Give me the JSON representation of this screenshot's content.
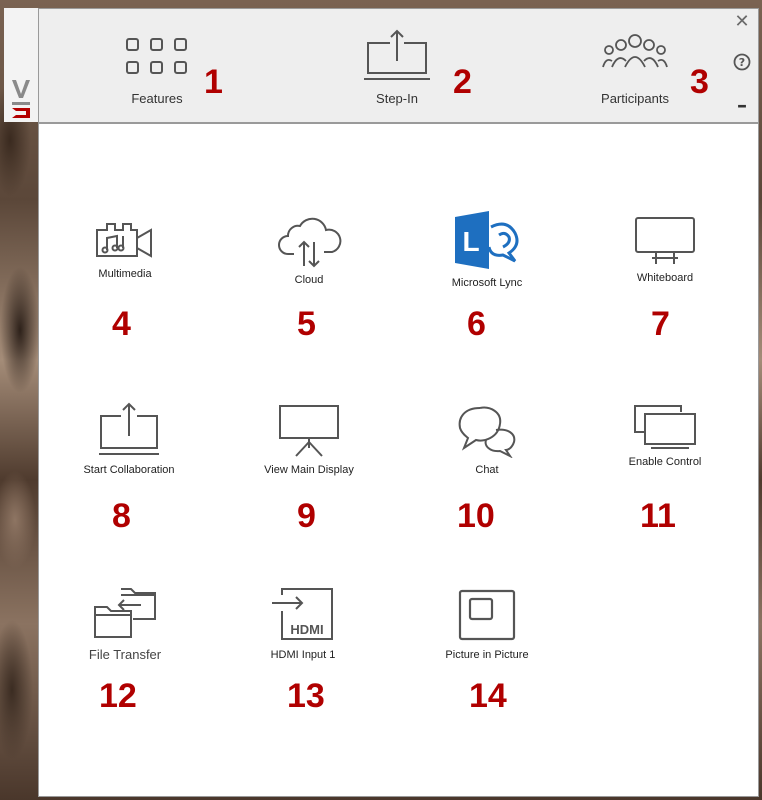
{
  "toolbar": {
    "features": {
      "label": "Features",
      "callout": "1",
      "icon": "grid-icon"
    },
    "step_in": {
      "label": "Step-In",
      "callout": "2",
      "icon": "screen-upload-icon"
    },
    "participants": {
      "label": "Participants",
      "callout": "3",
      "icon": "people-icon"
    }
  },
  "window_controls": {
    "close": "✕",
    "help": "?",
    "minimize": "–"
  },
  "tiles": [
    {
      "label": "Multimedia",
      "callout": "4",
      "icon": "film-music-icon"
    },
    {
      "label": "Cloud",
      "callout": "5",
      "icon": "cloud-transfer-icon"
    },
    {
      "label": "Microsoft Lync",
      "callout": "6",
      "icon": "lync-logo-icon"
    },
    {
      "label": "Whiteboard",
      "callout": "7",
      "icon": "whiteboard-icon"
    },
    {
      "label": "Start Collaboration",
      "callout": "8",
      "icon": "screen-upload-icon"
    },
    {
      "label": "View Main Display",
      "callout": "9",
      "icon": "projector-screen-icon"
    },
    {
      "label": "Chat",
      "callout": "10",
      "icon": "chat-bubbles-icon"
    },
    {
      "label": "Enable Control",
      "callout": "11",
      "icon": "dual-screen-icon"
    },
    {
      "label": "File Transfer",
      "callout": "12",
      "icon": "folder-transfer-icon"
    },
    {
      "label": "HDMI Input 1",
      "callout": "13",
      "icon": "hdmi-input-icon"
    },
    {
      "label": "Picture in Picture",
      "callout": "14",
      "icon": "picture-in-picture-icon"
    }
  ],
  "colors": {
    "callout": "#b00000",
    "lync_blue": "#1e6fc0",
    "topbar": "#eeeeee"
  },
  "hdmi_text": "HDMI"
}
